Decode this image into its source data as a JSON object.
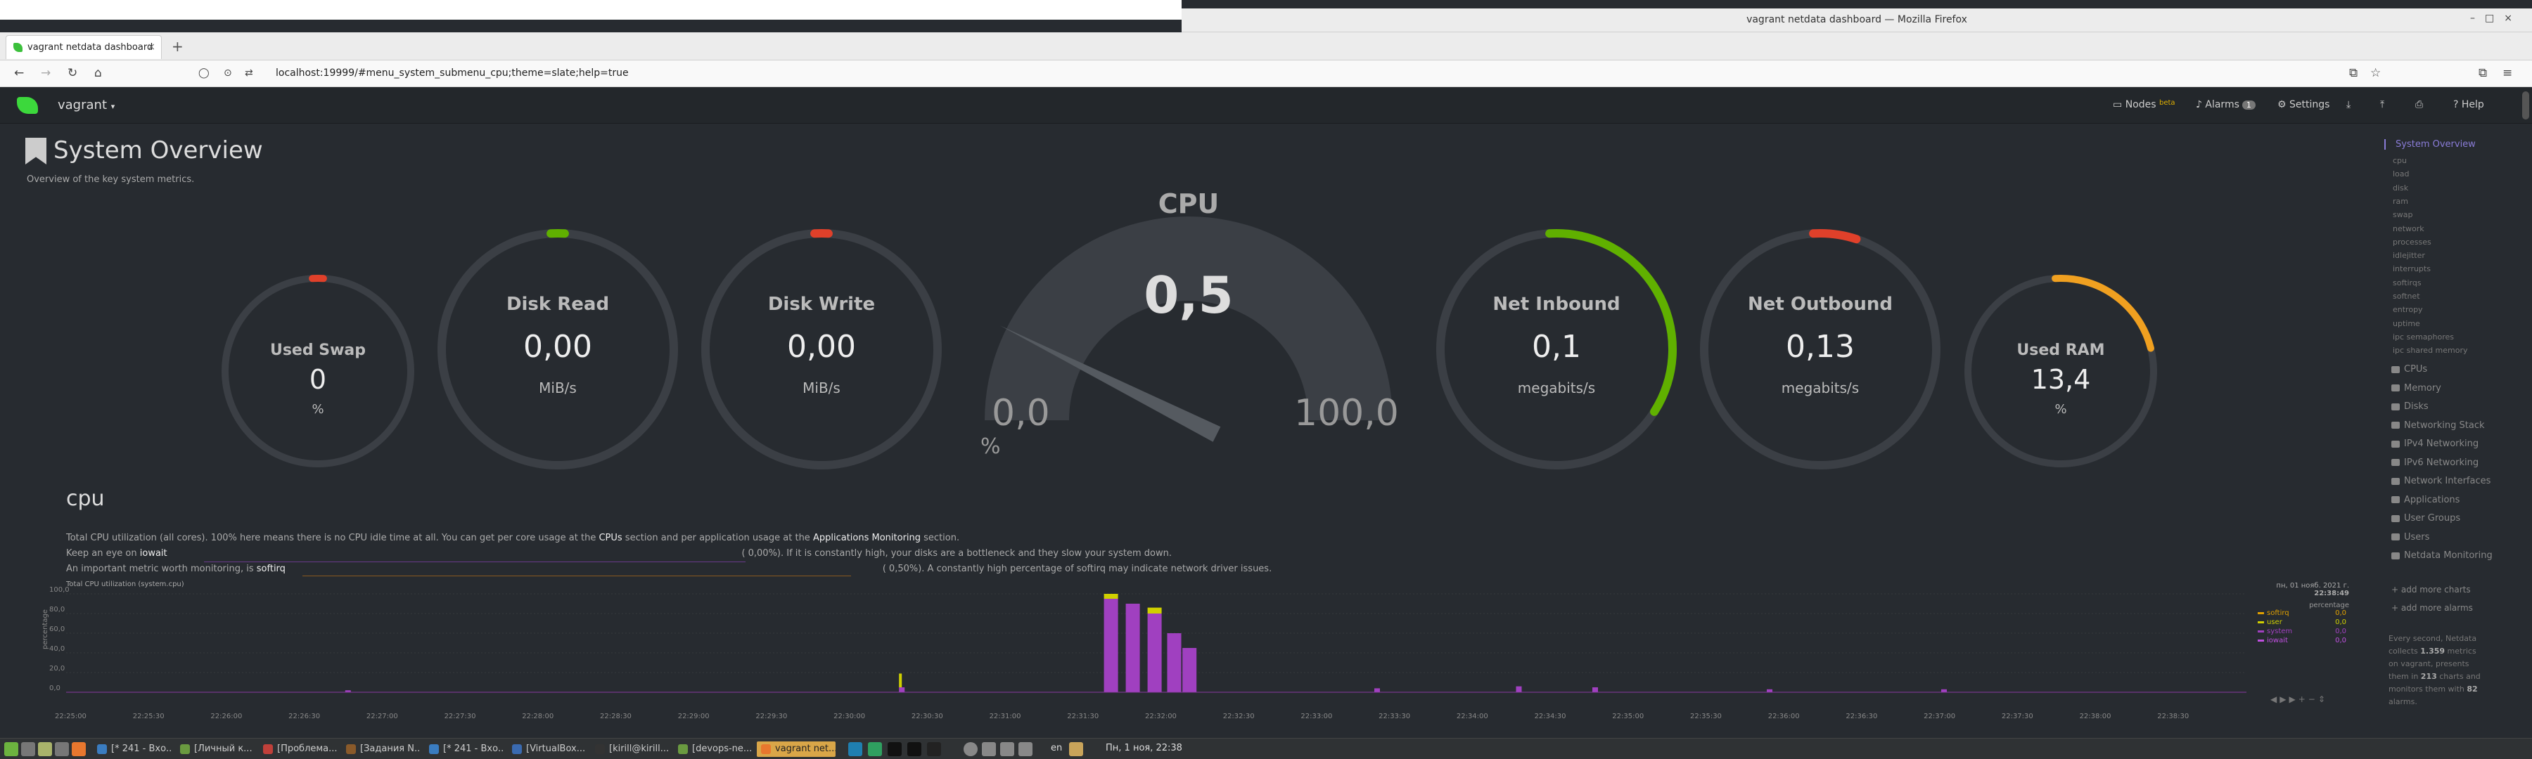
{
  "window": {
    "title": "vagrant netdata dashboard — Mozilla Firefox"
  },
  "browser": {
    "tab_title": "vagrant netdata dashboard",
    "tab_close": "×",
    "new_tab": "+",
    "url": "localhost:19999/#menu_system_submenu_cpu;theme=slate;help=true"
  },
  "header": {
    "hostname": "vagrant",
    "nodes": "Nodes",
    "nodes_badge": "beta",
    "alarms": "Alarms",
    "alarms_count": "1",
    "settings": "Settings",
    "help": "Help"
  },
  "overview": {
    "title": "System Overview",
    "subtitle": "Overview of the key system metrics."
  },
  "gauges": [
    {
      "title": "Used Swap",
      "value": "0",
      "unit": "%",
      "level": 0.0,
      "color": "#e0402a"
    },
    {
      "title": "Disk Read",
      "value": "0,00",
      "unit": "MiB/s",
      "level": 0.0,
      "color": "#60b000"
    },
    {
      "title": "Disk Write",
      "value": "0,00",
      "unit": "MiB/s",
      "level": 0.0,
      "color": "#e0402a"
    },
    {
      "title": "Net Inbound",
      "value": "0,1",
      "unit": "megabits/s",
      "level": 0.35,
      "color": "#60b000"
    },
    {
      "title": "Net Outbound",
      "value": "0,13",
      "unit": "megabits/s",
      "level": 0.06,
      "color": "#e0402a"
    },
    {
      "title": "Used RAM",
      "value": "13,4",
      "unit": "%",
      "level": 0.22,
      "color": "#f0a020"
    }
  ],
  "cpu_gauge": {
    "title": "CPU",
    "value": "0,5",
    "min": "0,0",
    "max": "100,0",
    "unit": "%",
    "level": 0.005
  },
  "cpu_section": {
    "heading": "cpu",
    "desc1_a": "Total CPU utilization (all cores). 100% here means there is no CPU idle time at all. You can get per core usage at the ",
    "desc1_b": "CPUs",
    "desc1_c": " section and per application usage at the ",
    "desc1_d": "Applications Monitoring",
    "desc1_e": " section.",
    "desc2_a": "Keep an eye on ",
    "desc2_b": "iowait",
    "desc2_c": "0,00%). If it is constantly high, your disks are a bottleneck and they slow your system down.",
    "desc3_a": "An important metric worth monitoring, is ",
    "desc3_b": "softirq",
    "desc3_c": "0,50%). A constantly high percentage of softirq may indicate network driver issues."
  },
  "chart_data": {
    "type": "area",
    "title": "Total CPU utilization (system.cpu)",
    "ylabel": "percentage",
    "ylim": [
      0,
      100
    ],
    "yticks": [
      "100,0",
      "80,0",
      "60,0",
      "40,0",
      "20,0",
      "0,0"
    ],
    "xticks": [
      "22:25:00",
      "22:25:30",
      "22:26:00",
      "22:26:30",
      "22:27:00",
      "22:27:30",
      "22:28:00",
      "22:28:30",
      "22:29:00",
      "22:29:30",
      "22:30:00",
      "22:30:30",
      "22:31:00",
      "22:31:30",
      "22:32:00",
      "22:32:30",
      "22:33:00",
      "22:33:30",
      "22:34:00",
      "22:34:30",
      "22:35:00",
      "22:35:30",
      "22:36:00",
      "22:36:30",
      "22:37:00",
      "22:37:30",
      "22:38:00",
      "22:38:30"
    ],
    "legend_date": "пн, 01 нояб. 2021 г.",
    "legend_time": "22:38:49",
    "legend_unit": "percentage",
    "series": [
      {
        "name": "softirq",
        "value": "0,0",
        "color": "#e0a000"
      },
      {
        "name": "user",
        "value": "0,0",
        "color": "#d0d000"
      },
      {
        "name": "system",
        "value": "0,0",
        "color": "#a040c0"
      },
      {
        "name": "iowait",
        "value": "0,0",
        "color": "#c050e0"
      }
    ],
    "spikes": [
      {
        "t": 0.128,
        "system": 2,
        "user": 0
      },
      {
        "t": 0.382,
        "system": 5,
        "user": 14
      },
      {
        "t": 0.476,
        "system": 95,
        "user": 5
      },
      {
        "t": 0.486,
        "system": 90,
        "user": 0
      },
      {
        "t": 0.496,
        "system": 80,
        "user": 6
      },
      {
        "t": 0.505,
        "system": 60,
        "user": 0
      },
      {
        "t": 0.512,
        "system": 45,
        "user": 0
      },
      {
        "t": 0.6,
        "system": 4,
        "user": 0
      },
      {
        "t": 0.665,
        "system": 6,
        "user": 0
      },
      {
        "t": 0.7,
        "system": 5,
        "user": 0
      },
      {
        "t": 0.78,
        "system": 3,
        "user": 0
      },
      {
        "t": 0.86,
        "system": 3,
        "user": 0
      }
    ]
  },
  "sidebar": {
    "active": "System Overview",
    "subitems": [
      "cpu",
      "load",
      "disk",
      "ram",
      "swap",
      "network",
      "processes",
      "idlejitter",
      "interrupts",
      "softirqs",
      "softnet",
      "entropy",
      "uptime",
      "ipc semaphores",
      "ipc shared memory"
    ],
    "menus": [
      "CPUs",
      "Memory",
      "Disks",
      "Networking Stack",
      "IPv4 Networking",
      "IPv6 Networking",
      "Network Interfaces",
      "Applications",
      "User Groups",
      "Users",
      "Netdata Monitoring"
    ],
    "add_charts": "add more charts",
    "add_alarms": "add more alarms",
    "footer_a": "Every second, Netdata collects ",
    "footer_metrics": "1.359",
    "footer_b": " metrics on vagrant, presents them in ",
    "footer_charts": "213",
    "footer_c": " charts and monitors them with ",
    "footer_alarms": "82",
    "footer_d": " alarms."
  },
  "taskbar": {
    "items": [
      "[* 241 - Вхо...",
      "[Личный к...",
      "[Проблема...",
      "[Задания N...",
      "[* 241 - Вхо...",
      "[VirtualBox...",
      "[kirill@kirill...",
      "[devops-ne...",
      "vagrant net..."
    ],
    "lang": "en",
    "clock": "Пн, 1 ноя, 22:38"
  }
}
